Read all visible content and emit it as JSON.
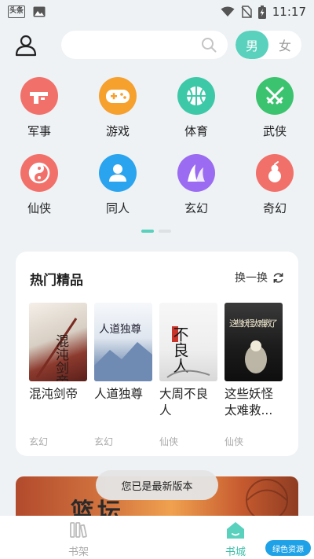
{
  "status_bar": {
    "app_badge": "头条",
    "time": "11:17"
  },
  "header": {
    "search": {
      "placeholder": ""
    },
    "gender_toggle": {
      "male": "男",
      "female": "女",
      "selected": "男"
    }
  },
  "categories": [
    {
      "label": "军事",
      "icon": "military-icon",
      "color": "#f2706a"
    },
    {
      "label": "游戏",
      "icon": "gamepad-icon",
      "color": "#f6a02e"
    },
    {
      "label": "体育",
      "icon": "basketball-icon",
      "color": "#3dc9a8"
    },
    {
      "label": "武侠",
      "icon": "swords-icon",
      "color": "#3cc36f"
    },
    {
      "label": "仙侠",
      "icon": "yin-yang-icon",
      "color": "#f2706a"
    },
    {
      "label": "同人",
      "icon": "person-icon",
      "color": "#2aa4ee"
    },
    {
      "label": "玄幻",
      "icon": "mountain-icon",
      "color": "#9b6bf1"
    },
    {
      "label": "奇幻",
      "icon": "gourd-icon",
      "color": "#f2706a"
    }
  ],
  "pager": {
    "pages": 2,
    "active": 0
  },
  "hot_section": {
    "title": "热门精品",
    "refresh_label": "换一换",
    "books": [
      {
        "title": "混沌剑帝",
        "genre": "玄幻",
        "cover_text": "混沌剑帝"
      },
      {
        "title": "人道独尊",
        "genre": "玄幻",
        "cover_text": "人道独尊"
      },
      {
        "title": "大周不良人",
        "genre": "仙侠",
        "cover_text": "不良人"
      },
      {
        "title": "这些妖怪太难救...",
        "genre": "仙侠",
        "cover_text": "这些妖怪太难救了"
      }
    ]
  },
  "banner": {
    "text": "篮坛"
  },
  "toast": "您已是最新版本",
  "bottom_nav": [
    {
      "label": "书架",
      "icon": "bookshelf-icon",
      "active": false
    },
    {
      "label": "书城",
      "icon": "home-icon",
      "active": true
    }
  ],
  "watermark": "绿色资源"
}
